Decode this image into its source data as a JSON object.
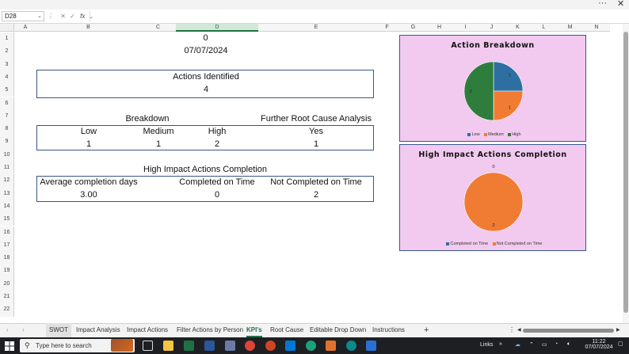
{
  "window": {
    "menu_glyph": "···",
    "close_glyph": "✕"
  },
  "formula_bar": {
    "name_box": "D28",
    "fx_symbol": "fx",
    "formula": ""
  },
  "columns": [
    "A",
    "B",
    "C",
    "D",
    "E",
    "F",
    "G",
    "H",
    "I",
    "J",
    "K",
    "L",
    "M",
    "N"
  ],
  "rows": [
    "1",
    "2",
    "3",
    "4",
    "5",
    "6",
    "7",
    "8",
    "9",
    "10",
    "11",
    "12",
    "13",
    "14",
    "15",
    "16",
    "17",
    "18",
    "19",
    "20",
    "21",
    "22"
  ],
  "sheet": {
    "d1": "0",
    "d2": "07/07/2024",
    "actions_identified_label": "Actions Identified",
    "actions_identified_value": "4",
    "breakdown_label": "Breakdown",
    "further_rca_label": "Further Root Cause Analysis",
    "low_label": "Low",
    "medium_label": "Medium",
    "high_label": "High",
    "yes_label": "Yes",
    "low_value": "1",
    "medium_value": "1",
    "high_value": "2",
    "yes_value": "1",
    "hi_completion_label": "High Impact Actions Completion",
    "avg_days_label": "Average completion days",
    "completed_label": "Completed on Time",
    "not_completed_label": "Not Completed on Time",
    "avg_days_value": "3.00",
    "completed_value": "0",
    "not_completed_value": "2"
  },
  "chart_data": [
    {
      "type": "pie",
      "title": "Action Breakdown",
      "categories": [
        "Low",
        "Medium",
        "High"
      ],
      "values": [
        1,
        1,
        2
      ],
      "data_labels": [
        "1",
        "1",
        "2"
      ],
      "colors": [
        "#2e6fa2",
        "#f07c33",
        "#2e7d3c"
      ],
      "legend": "bottom"
    },
    {
      "type": "pie",
      "title": "High Impact Actions Completion",
      "categories": [
        "Completed on Time",
        "Not Completed on Time"
      ],
      "values": [
        0,
        2
      ],
      "data_labels": [
        "0",
        "2"
      ],
      "colors": [
        "#2e6fa2",
        "#f07c33"
      ],
      "legend": "bottom"
    }
  ],
  "tabs": [
    "SWOT",
    "Impact Analysis",
    "Impact Actions",
    "Filter Actions by Person",
    "KPI's",
    "Root Cause",
    "Editable Drop Down",
    "Instructions"
  ],
  "active_tab": "KPI's",
  "add_sheet": "+",
  "taskbar": {
    "search_placeholder": "Type here to search",
    "links": "Links",
    "time": "11:22",
    "date": "07/07/2024"
  }
}
